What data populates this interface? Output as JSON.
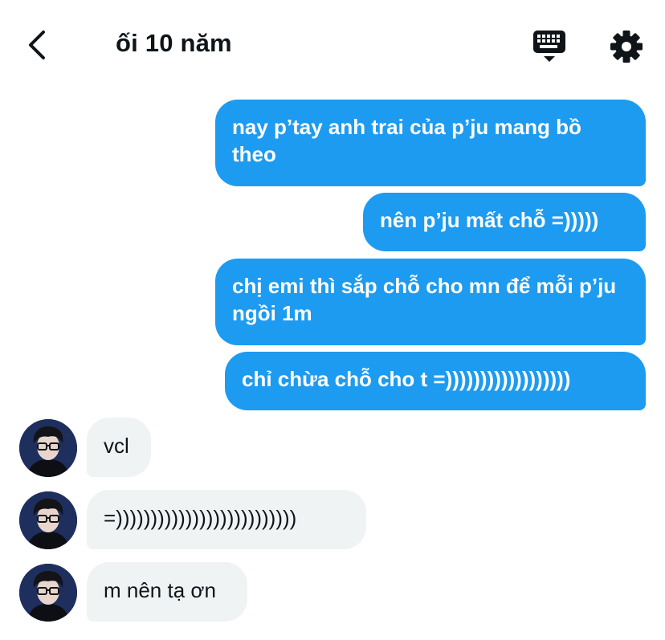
{
  "header": {
    "title": "ối 10 năm",
    "back_icon": "chevron-left-icon",
    "keyboard_icon": "keyboard-icon",
    "settings_icon": "gear-icon"
  },
  "messages": [
    {
      "side": "out",
      "text": "nay p’tay anh trai của p’ju mang bồ theo"
    },
    {
      "side": "out",
      "text": "nên p’ju mất chỗ =)))))"
    },
    {
      "side": "out",
      "text": "chị emi thì sắp chỗ cho mn để mỗi p’ju ngồi 1m"
    },
    {
      "side": "out",
      "text": "chỉ chừa chỗ cho t =))))))))))))))))))"
    },
    {
      "side": "in",
      "text": "vcl"
    },
    {
      "side": "in",
      "text": "=))))))))))))))))))))))))))"
    },
    {
      "side": "in",
      "text": "m nên tạ ơn"
    }
  ],
  "colors": {
    "outgoing_bubble": "#1d9bf0",
    "incoming_bubble": "#eff3f4",
    "text_dark": "#0f1419"
  }
}
